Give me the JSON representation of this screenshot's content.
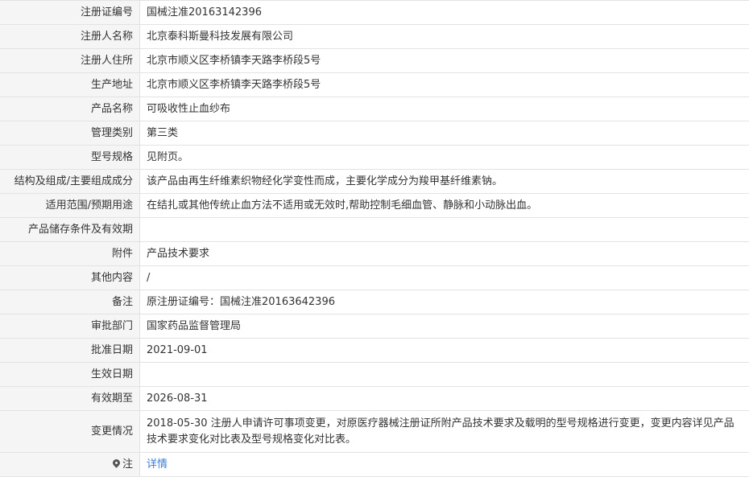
{
  "rows": [
    {
      "label": "注册证编号",
      "value": "国械注准20163142396"
    },
    {
      "label": "注册人名称",
      "value": "北京泰科斯曼科技发展有限公司"
    },
    {
      "label": "注册人住所",
      "value": "北京市顺义区李桥镇李天路李桥段5号"
    },
    {
      "label": "生产地址",
      "value": "北京市顺义区李桥镇李天路李桥段5号"
    },
    {
      "label": "产品名称",
      "value": "可吸收性止血纱布"
    },
    {
      "label": "管理类别",
      "value": "第三类"
    },
    {
      "label": "型号规格",
      "value": "见附页。"
    },
    {
      "label": "结构及组成/主要组成成分",
      "value": "该产品由再生纤维素织物经化学变性而成，主要化学成分为羧甲基纤维素钠。"
    },
    {
      "label": "适用范围/预期用途",
      "value": "在结扎或其他传统止血方法不适用或无效时,帮助控制毛细血管、静脉和小动脉出血。"
    },
    {
      "label": "产品储存条件及有效期",
      "value": ""
    },
    {
      "label": "附件",
      "value": "产品技术要求"
    },
    {
      "label": "其他内容",
      "value": "/"
    },
    {
      "label": "备注",
      "value": "原注册证编号：国械注准20163642396"
    },
    {
      "label": "审批部门",
      "value": "国家药品监督管理局"
    },
    {
      "label": "批准日期",
      "value": "2021-09-01"
    },
    {
      "label": "生效日期",
      "value": ""
    },
    {
      "label": "有效期至",
      "value": "2026-08-31"
    },
    {
      "label": "变更情况",
      "value": "2018-05-30 注册人申请许可事项变更，对原医疗器械注册证所附产品技术要求及载明的型号规格进行变更，变更内容详见产品技术要求变化对比表及型号规格变化对比表。"
    }
  ],
  "note": {
    "label": "注",
    "link_text": "详情",
    "icon": "pin-icon"
  }
}
